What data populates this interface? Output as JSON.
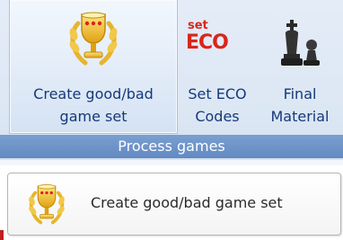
{
  "ribbon": {
    "buttons": [
      {
        "label_line1": "Create good/bad",
        "label_line2": "game set",
        "icon": "trophy-laurel-icon"
      },
      {
        "label_line1": "Set ECO",
        "label_line2": "Codes",
        "icon": "set-eco-icon",
        "icon_text_top": "set",
        "icon_text_main": "ECO"
      },
      {
        "label_line1": "Final",
        "label_line2": "Material",
        "icon": "chess-pieces-icon"
      }
    ],
    "group_label": "Process games"
  },
  "tooltip": {
    "text": "Create good/bad game set",
    "icon": "trophy-laurel-icon"
  },
  "colors": {
    "ribbon_bg": "#dce7f4",
    "group_label_bg": "#6d93c9",
    "label_text": "#15397a",
    "eco_red": "#d9251c"
  }
}
